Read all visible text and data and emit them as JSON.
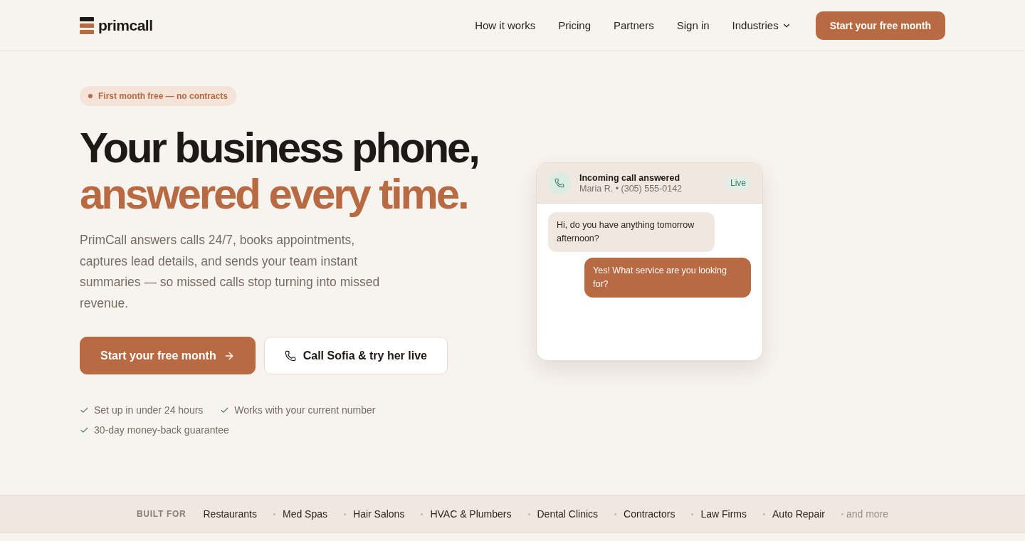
{
  "nav": {
    "logo": "primcall",
    "links": [
      {
        "label": "How it works",
        "kind": "link"
      },
      {
        "label": "Pricing",
        "kind": "link"
      },
      {
        "label": "Partners",
        "kind": "link"
      },
      {
        "label": "Sign in",
        "kind": "link"
      },
      {
        "label": "Industries",
        "kind": "dropdown"
      }
    ],
    "cta": "Start your free month"
  },
  "hero": {
    "badge": "First month free — no contracts",
    "headline": "Your business phone,",
    "headline_accent": "answered every time.",
    "description": "PrimCall answers calls 24/7, books appointments, captures lead details, and sends your team instant summaries — so missed calls stop turning into missed revenue.",
    "buttons": [
      {
        "label": "Start your free month",
        "kind": "primary"
      },
      {
        "label": "Call Sofia & try her live",
        "kind": "secondary"
      }
    ],
    "perks": [
      "Set up in under 24 hours",
      "Works with your current number",
      "30-day money-back guarantee"
    ]
  },
  "call_card": {
    "title": "Incoming call answered",
    "caller": "Maria R. • (305) 555-0142",
    "status": "Live",
    "messages": [
      {
        "kind": "incoming",
        "text": "Hi, do you have anything tomorrow afternoon?"
      },
      {
        "kind": "outgoing",
        "text": "Yes! What service are you looking for?"
      }
    ]
  },
  "industries": {
    "label": "BUILT FOR",
    "items": [
      "Restaurants",
      "Med Spas",
      "Hair Salons",
      "HVAC & Plumbers",
      "Dental Clinics",
      "Contractors",
      "Law Firms",
      "Auto Repair"
    ],
    "more": "and more"
  }
}
